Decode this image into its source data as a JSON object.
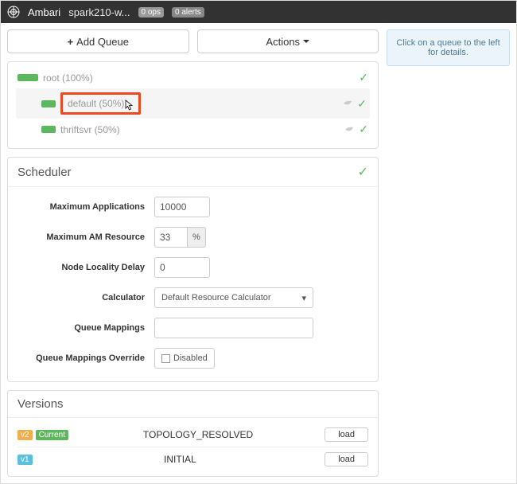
{
  "nav": {
    "brand": "Ambari",
    "cluster": "spark210-w...",
    "ops": "0 ops",
    "alerts": "0 alerts"
  },
  "toolbar": {
    "add_queue": "Add Queue",
    "actions": "Actions"
  },
  "queues": {
    "root": "root (100%)",
    "default": "default (50%)",
    "thriftsvr": "thriftsvr (50%)"
  },
  "side_message": "Click on a queue to the left for details.",
  "scheduler": {
    "title": "Scheduler",
    "max_apps_label": "Maximum Applications",
    "max_apps_value": "10000",
    "max_am_label": "Maximum AM Resource",
    "max_am_value": "33",
    "max_am_unit": "%",
    "node_locality_label": "Node Locality Delay",
    "node_locality_value": "0",
    "calculator_label": "Calculator",
    "calculator_value": "Default Resource Calculator",
    "queue_mappings_label": "Queue Mappings",
    "queue_mappings_value": "",
    "override_label": "Queue Mappings Override",
    "override_text": "Disabled"
  },
  "versions": {
    "title": "Versions",
    "v2_tag": "v2",
    "current_tag": "Current",
    "v2_name": "TOPOLOGY_RESOLVED",
    "v1_tag": "v1",
    "v1_name": "INITIAL",
    "load": "load"
  }
}
